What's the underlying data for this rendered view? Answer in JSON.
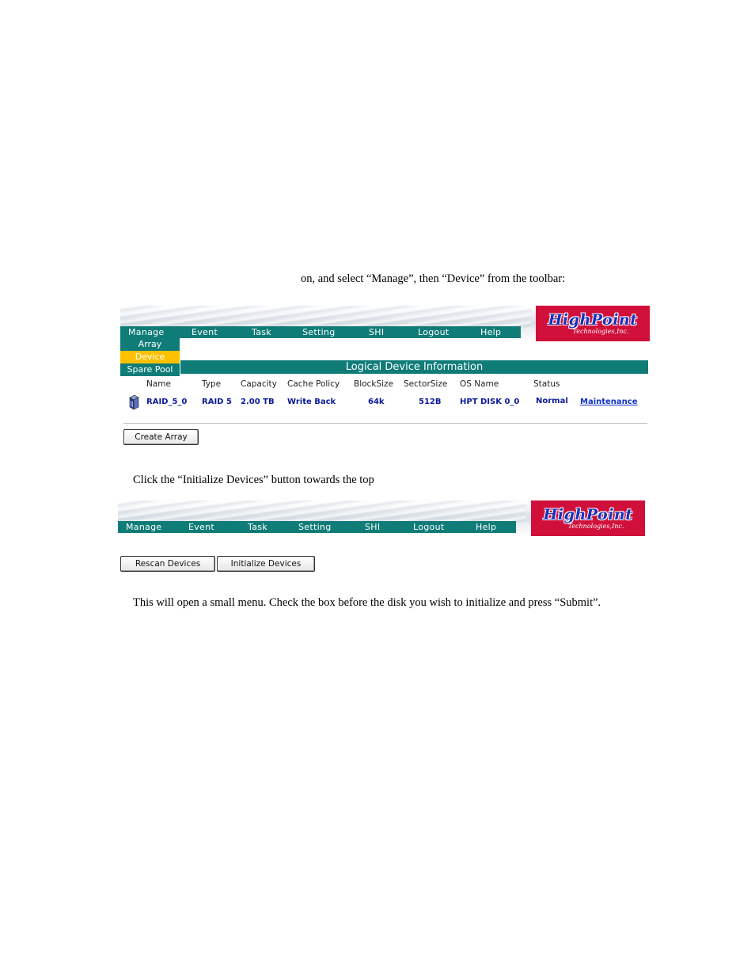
{
  "text": {
    "p1": "on, and select “Manage”, then “Device” from the toolbar:",
    "p2": "Click the “Initialize Devices” button towards the top",
    "p3": "This will open a small menu.  Check the box before the disk you wish to initialize and press “Submit”."
  },
  "screenshot1": {
    "nav": [
      "Manage",
      "Event",
      "Task",
      "Setting",
      "SHI",
      "Logout",
      "Help"
    ],
    "logo": {
      "word": "HighPoint",
      "sub": "Technologies,Inc."
    },
    "dropdown": [
      {
        "label": "Array",
        "active": false
      },
      {
        "label": "Device",
        "active": true
      },
      {
        "label": "Spare Pool",
        "active": false
      }
    ],
    "title": "Logical Device Information",
    "columns": [
      "Name",
      "Type",
      "Capacity",
      "Cache Policy",
      "BlockSize",
      "SectorSize",
      "OS Name",
      "Status"
    ],
    "row": {
      "name": "RAID_5_0",
      "type": "RAID 5",
      "capacity": "2.00 TB",
      "cache": "Write Back",
      "block": "64k",
      "sector": "512B",
      "os": "HPT DISK 0_0",
      "status": "Normal",
      "action": "Maintenance"
    },
    "button": "Create Array"
  },
  "screenshot2": {
    "nav": [
      "Manage",
      "Event",
      "Task",
      "Setting",
      "SHI",
      "Logout",
      "Help"
    ],
    "logo": {
      "word": "HighPoint",
      "sub": "Technologies,Inc."
    },
    "buttons": {
      "rescan": "Rescan Devices",
      "init": "Initialize Devices"
    }
  },
  "colors": {
    "nav": "#0f7c78",
    "logo_bg": "#d0103a",
    "dropdown_active": "#ffc000"
  }
}
